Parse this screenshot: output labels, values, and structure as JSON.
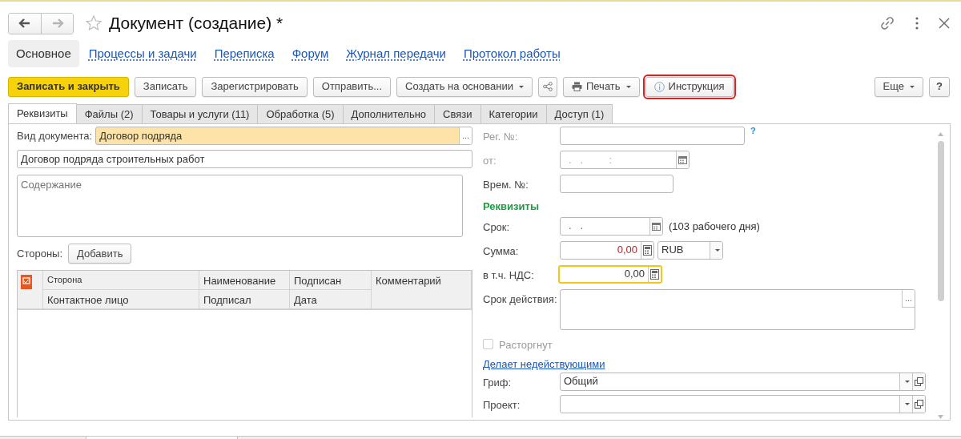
{
  "window": {
    "title": "Документ (создание) *",
    "favorite": false
  },
  "history_buttons": [
    {
      "kind": "back",
      "disabled": false
    },
    {
      "kind": "forward",
      "disabled": true
    }
  ],
  "nav_links": [
    {
      "label": "Основное",
      "selected": true
    },
    {
      "label": "Процессы и задачи",
      "selected": false
    },
    {
      "label": "Переписка",
      "selected": false
    },
    {
      "label": "Форум",
      "selected": false
    },
    {
      "label": "Журнал передачи",
      "selected": false
    },
    {
      "label": "Протокол работы",
      "selected": false
    }
  ],
  "toolbar": [
    {
      "label": "Записать и закрыть",
      "kind": "primary",
      "highlighted": false
    },
    {
      "label": "Записать",
      "kind": "plain",
      "highlighted": false
    },
    {
      "label": "Зарегистрировать",
      "kind": "plain",
      "highlighted": false
    },
    {
      "label": "Отправить...",
      "kind": "plain",
      "highlighted": false
    },
    {
      "label": "Создать на основании",
      "kind": "dropdown",
      "highlighted": false
    },
    {
      "kind": "share",
      "highlighted": false
    },
    {
      "label": "Печать",
      "kind": "print",
      "highlighted": false
    },
    {
      "label": "Инструкция",
      "kind": "info",
      "highlighted": true
    }
  ],
  "toolbar_right": [
    {
      "label": "Еще",
      "kind": "dropdown"
    },
    {
      "label": "?",
      "kind": "help"
    }
  ],
  "tabs": [
    {
      "label": "Реквизиты",
      "selected": true
    },
    {
      "label": "Файлы (2)",
      "selected": false
    },
    {
      "label": "Товары и услуги (11)",
      "selected": false
    },
    {
      "label": "Обработка (5)",
      "selected": false
    },
    {
      "label": "Дополнительно",
      "selected": false
    },
    {
      "label": "Связи",
      "selected": false
    },
    {
      "label": "Категории",
      "selected": false
    },
    {
      "label": "Доступ (1)",
      "selected": false
    }
  ],
  "left_form": {
    "doc_type": {
      "label": "Вид документа:",
      "value": "Договор подряда",
      "select_button": "..."
    },
    "title_value": "Договор подряда строительных работ",
    "content_placeholder": "Содержание",
    "parties": {
      "label": "Стороны:",
      "add_button": "Добавить"
    },
    "table": {
      "columns": [
        {
          "top": "Сторона",
          "bottom": "Контактное лицо"
        },
        {
          "top": "Наименование",
          "bottom": "Подписал"
        },
        {
          "top": "Подписан",
          "bottom": "Дата"
        },
        {
          "top": "Комментарий"
        }
      ]
    }
  },
  "right_form": [
    {
      "kind": "text",
      "label": "Рег. №:",
      "disabled": true,
      "help": "?"
    },
    {
      "kind": "date",
      "label": "от:",
      "placeholder": ".   .         :",
      "disabled": true
    },
    {
      "kind": "short",
      "label": "Врем. №:",
      "disabled": false
    },
    {
      "kind": "heading",
      "label": "Реквизиты"
    },
    {
      "kind": "date",
      "label": "Срок:",
      "placeholder": ".   .",
      "disabled": false,
      "note": "(103 рабочего дня)"
    },
    {
      "kind": "amount",
      "label": "Сумма:",
      "value": "0,00",
      "invalid": true,
      "focused": false,
      "currency": "RUB"
    },
    {
      "kind": "amount",
      "label": "в т.ч. НДС:",
      "value": "0,00",
      "invalid": false,
      "focused": true
    },
    {
      "kind": "textarea",
      "label": "Срок действия:",
      "select_button": "..."
    },
    {
      "kind": "checkbox",
      "label": "Расторгнут",
      "checked": false,
      "disabled": true
    },
    {
      "kind": "link",
      "label": "Делает недействующими"
    },
    {
      "kind": "combo",
      "label": "Гриф:",
      "value": "Общий"
    },
    {
      "kind": "combo",
      "label": "Проект:"
    }
  ]
}
